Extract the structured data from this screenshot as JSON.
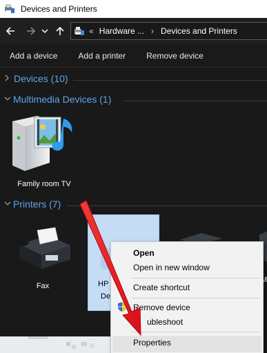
{
  "window": {
    "title": "Devices and Printers"
  },
  "navigation": {
    "back_icon": "back-arrow-icon",
    "forward_icon": "forward-arrow-icon",
    "recent_icon": "chevron-down-icon",
    "up_icon": "up-arrow-icon",
    "overflow_marker": "«",
    "breadcrumbs": [
      {
        "label": "Hardware ..."
      },
      {
        "label": "Devices and Printers"
      }
    ],
    "crumb_separator": "›"
  },
  "commands": {
    "add_device": "Add a device",
    "add_printer": "Add a printer",
    "remove_device": "Remove device"
  },
  "groups": {
    "devices": {
      "label": "Devices (10)",
      "expanded": false
    },
    "multimedia": {
      "label": "Multimedia Devices (1)",
      "expanded": true
    },
    "printers": {
      "label": "Printers (7)",
      "expanded": true
    }
  },
  "multimedia_items": [
    {
      "label": "Family room TV",
      "icon": "media-device-icon"
    }
  ],
  "printer_items": [
    {
      "label": "Fax",
      "icon": "fax-icon"
    },
    {
      "label_line1": "HP",
      "label_line2": "De",
      "icon": "printer-icon",
      "selected": true
    },
    {
      "label_line1": "M",
      "label_line2": "",
      "icon": "printer-icon"
    }
  ],
  "context_menu": {
    "open": "Open",
    "open_new_window": "Open in new window",
    "create_shortcut": "Create shortcut",
    "remove_device": "Remove device",
    "troubleshoot": "ubleshoot",
    "properties": "Properties"
  },
  "colors": {
    "background": "#191919",
    "group_header": "#5ea5e8",
    "menu_background": "#f2f2f2",
    "arrow": "#e8141c",
    "selection": "#c5dcf5"
  }
}
